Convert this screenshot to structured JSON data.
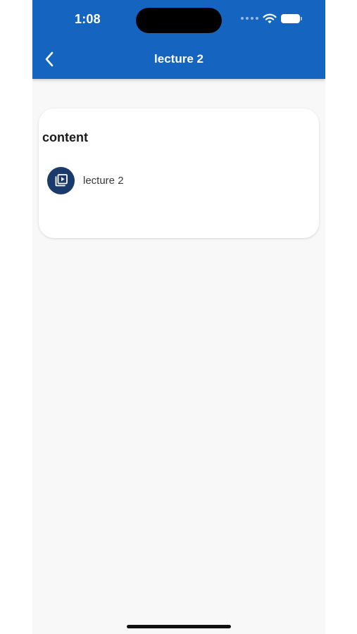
{
  "status_bar": {
    "time": "1:08"
  },
  "header": {
    "title": "lecture 2",
    "back_icon": "chevron-left-icon"
  },
  "content_card": {
    "heading": "content",
    "items": [
      {
        "label": "lecture 2",
        "icon": "video-library-icon"
      }
    ]
  },
  "colors": {
    "app_bar": "#1565c0",
    "icon_circle": "#1a3a6b",
    "background": "#f8f8f8"
  }
}
